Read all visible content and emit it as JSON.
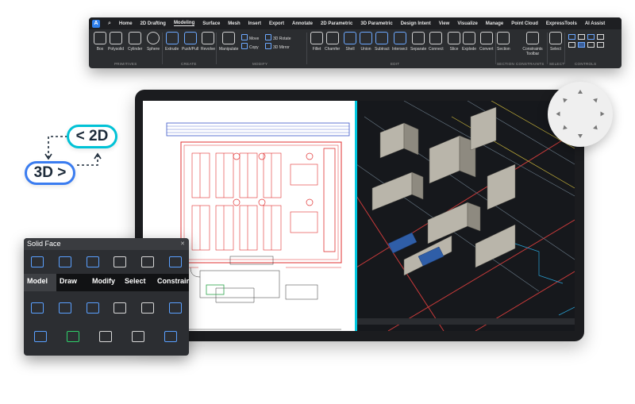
{
  "ribbon": {
    "app_button": "A",
    "tabs": [
      "Home",
      "2D Drafting",
      "Modeling",
      "Surface",
      "Mesh",
      "Insert",
      "Export",
      "Annotate",
      "2D Parametric",
      "3D Parametric",
      "Design Intent",
      "View",
      "Visualize",
      "Manage",
      "Point Cloud",
      "ExpressTools",
      "AI Assist"
    ],
    "active_tab": "Modeling",
    "tools": {
      "box": "Box",
      "polysolid": "Polysolid",
      "cylinder": "Cylinder",
      "sphere": "Sphere",
      "extrude": "Extrude",
      "pushpull": "Push/Pull",
      "revolve": "Revolve",
      "manipulate": "Manipulate",
      "move": "Move",
      "copy": "Copy",
      "rotate3d": "3D Rotate",
      "mirror3d": "3D Mirror",
      "fillet": "Fillet",
      "chamfer": "Chamfer",
      "shell": "Shell",
      "union": "Union",
      "subtract": "Subtract",
      "intersect": "Intersect",
      "separate": "Separate",
      "connect": "Connect",
      "slice": "Slice",
      "explode": "Explode",
      "convert": "Convert",
      "section": "Section",
      "constraints_toolbar": "Constraints Toolbar",
      "select": "Select"
    },
    "groups": {
      "primitives": "PRIMITIVES",
      "create": "CREATE",
      "modify": "MODIFY",
      "edit": "EDIT",
      "section": "SECTION",
      "constraints": "CONSTRAINTS",
      "select": "SELECT",
      "controls": "CONTROLS"
    }
  },
  "badges": {
    "two_d": "< 2D",
    "three_d": "3D >"
  },
  "panel": {
    "title": "Solid Face",
    "tabs": [
      "Model",
      "Draw",
      "Modify",
      "Select",
      "Constraint"
    ],
    "active_tab": "Model"
  }
}
